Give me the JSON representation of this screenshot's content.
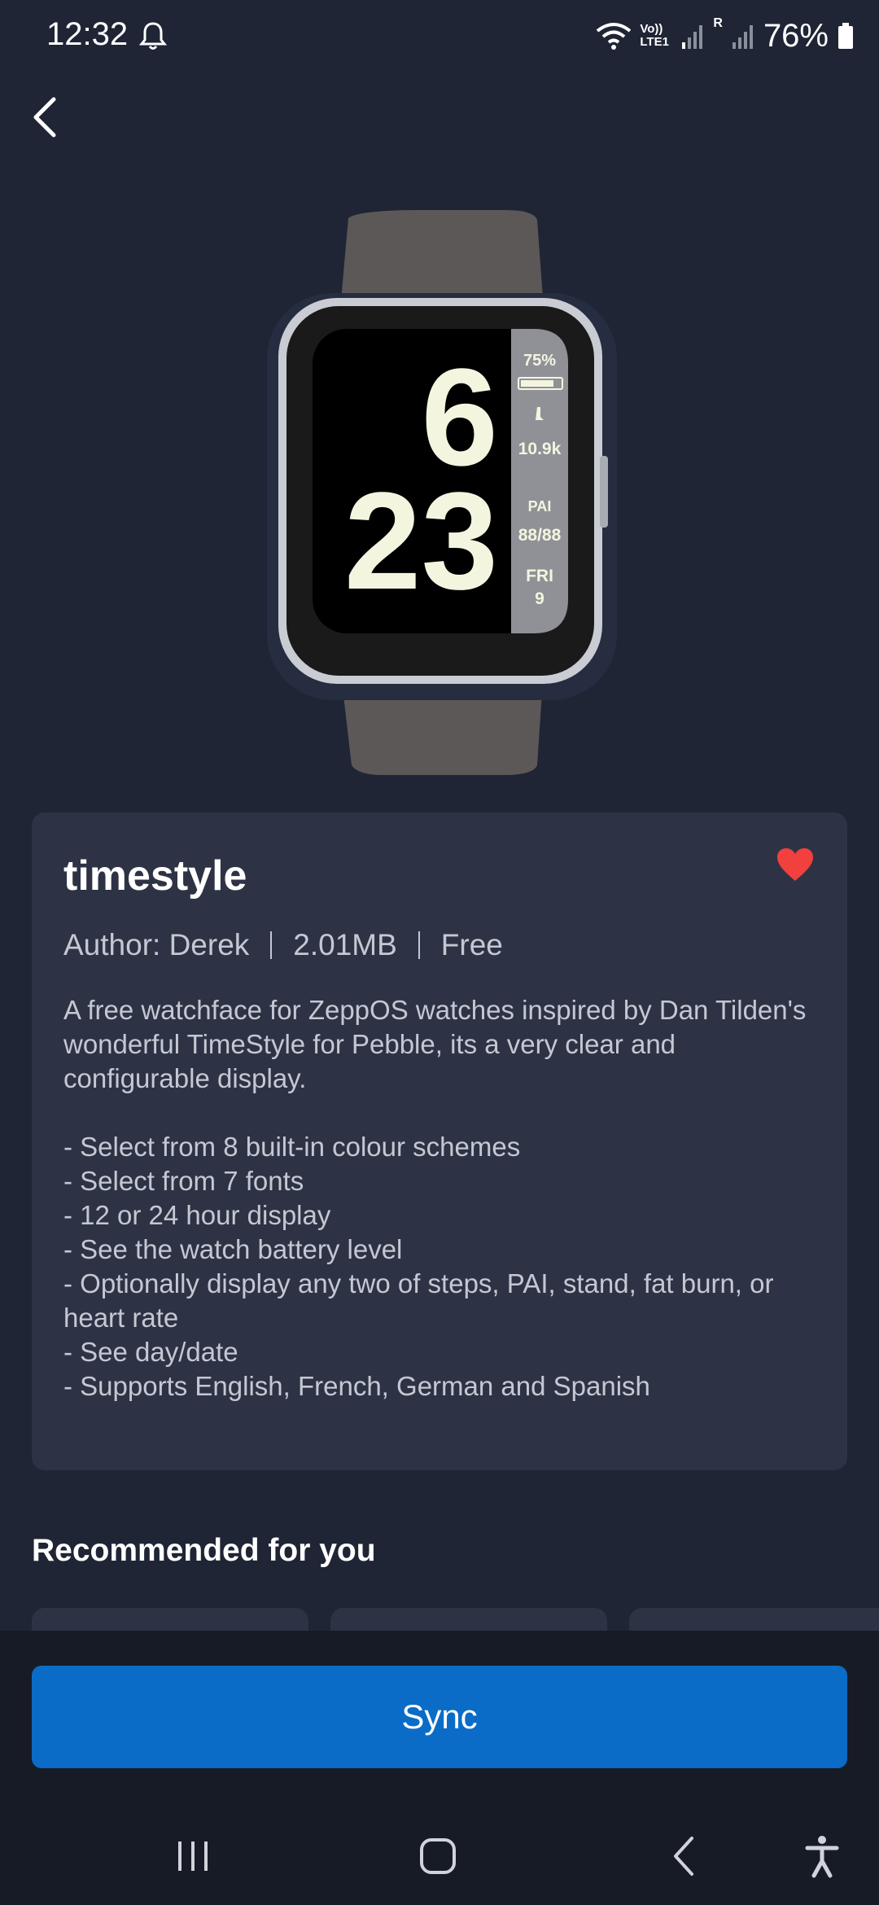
{
  "status_bar": {
    "time": "12:32",
    "network": "Vo)) LTE1",
    "roaming": "R",
    "battery_percent": "76%"
  },
  "watch_preview": {
    "hour": "6",
    "minute": "23",
    "battery": "75%",
    "steps": "10.9k",
    "pai_label": "PAI",
    "pai_value": "88/88",
    "day": "FRI",
    "date": "9"
  },
  "detail": {
    "title": "timestyle",
    "author": "Author: Derek",
    "size": "2.01MB",
    "price": "Free",
    "favorited": true,
    "description": "A free watchface for ZeppOS watches inspired by Dan Tilden's wonderful TimeStyle for Pebble, its a very clear and configurable display.\n\n- Select from 8 built-in colour schemes\n- Select from 7 fonts\n- 12 or 24 hour display\n- See the watch battery level\n- Optionally display any two of steps, PAI, stand, fat burn, or heart rate\n- See day/date\n- Supports English, French, German and Spanish"
  },
  "recommended": {
    "title": "Recommended for you"
  },
  "actions": {
    "sync_label": "Sync"
  },
  "colors": {
    "background": "#1f2535",
    "card": "#2d3345",
    "accent": "#0a6cc7",
    "heart": "#f2403f",
    "watch_text": "#f3f5df"
  }
}
